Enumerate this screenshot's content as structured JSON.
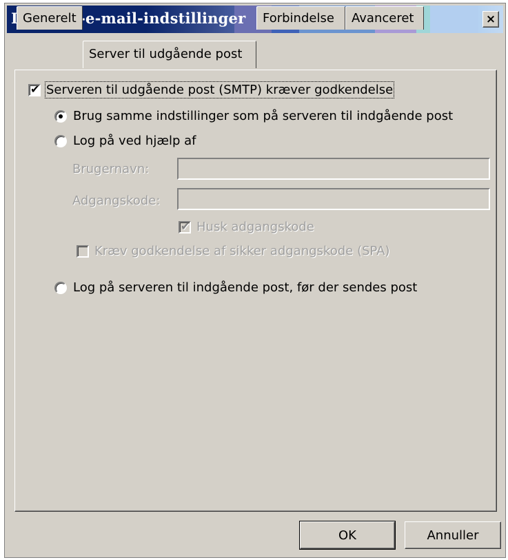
{
  "window": {
    "title": "Internet-e-mail-indstillinger",
    "close_label": "×"
  },
  "tabs": [
    {
      "label": "Generelt",
      "active": false
    },
    {
      "label": "Server til udgående post",
      "active": true
    },
    {
      "label": "Forbindelse",
      "active": false
    },
    {
      "label": "Avanceret",
      "active": false
    }
  ],
  "outgoing": {
    "smtp_auth": {
      "label": "Serveren til udgående post (SMTP) kræver godkendelse",
      "checked": true
    },
    "use_same": {
      "label": "Brug samme indstillinger som på serveren til indgående post",
      "selected": true
    },
    "log_on_with": {
      "label": "Log på ved hjælp af",
      "selected": false
    },
    "username": {
      "label": "Brugernavn:",
      "value": ""
    },
    "password": {
      "label": "Adgangskode:",
      "value": ""
    },
    "remember_password": {
      "label": "Husk adgangskode",
      "checked": true
    },
    "spa": {
      "label": "Kræv godkendelse af sikker adgangskode (SPA)",
      "checked": false
    },
    "log_on_incoming": {
      "label": "Log på serveren til indgående post, før der sendes post",
      "selected": false
    }
  },
  "buttons": {
    "ok": "OK",
    "cancel": "Annuller"
  },
  "colors": {
    "title_gradient_start": "#0a246a",
    "title_gradient_end": "#a6caf0",
    "dialog_face": "#d4d0c8",
    "disabled_text": "#a0a0a0"
  }
}
